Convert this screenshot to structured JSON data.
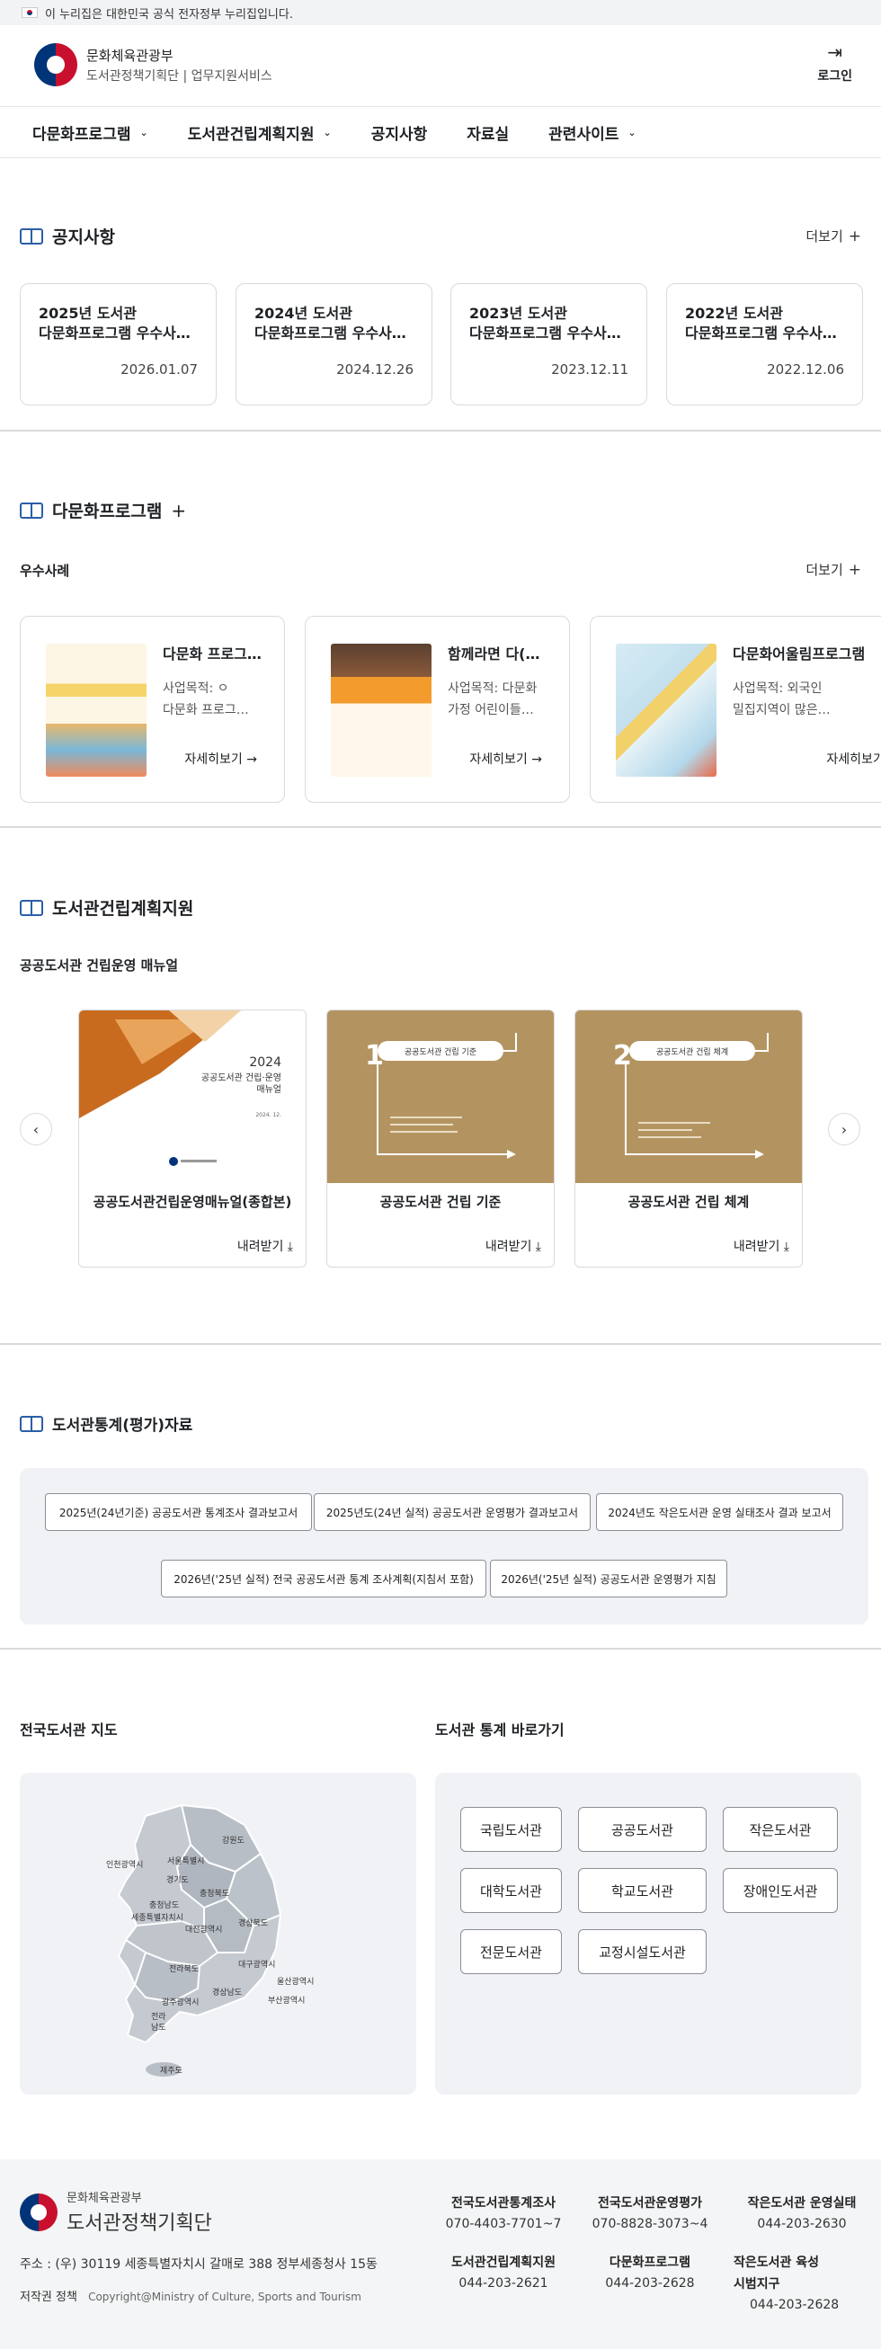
{
  "gov_banner": {
    "text": "이 누리집은 대한민국 공식 전자정부 누리집입니다."
  },
  "header": {
    "org": "문화체육관광부",
    "service": "도서관정책기획단 | 업무지원서비스",
    "login": "로그인"
  },
  "nav": [
    "다문화프로그램",
    "도서관건립계획지원",
    "공지사항",
    "자료실",
    "관련사이트"
  ],
  "notice": {
    "title": "공지사항",
    "more": "더보기",
    "items": [
      {
        "title1": "2025년 도서관",
        "title2": "다문화프로그램 우수사…",
        "date": "2026.01.07"
      },
      {
        "title1": "2024년 도서관",
        "title2": "다문화프로그램 우수사…",
        "date": "2024.12.26"
      },
      {
        "title1": "2023년 도서관",
        "title2": "다문화프로그램 우수사…",
        "date": "2023.12.11"
      },
      {
        "title1": "2022년 도서관",
        "title2": "다문화프로그램 우수사…",
        "date": "2022.12.06"
      }
    ]
  },
  "program": {
    "title": "다문화프로그램",
    "sub": "우수사례",
    "more": "더보기",
    "items": [
      {
        "title": "다문화 프로그…",
        "desc1": "사업목적: ㅇ",
        "desc2": "다문화 프로그…",
        "link": "자세히보기"
      },
      {
        "title": "함께라면 다(…",
        "desc1": "사업목적: 다문화",
        "desc2": "가정 어린이들…",
        "link": "자세히보기"
      },
      {
        "title": "다문화어울림프로그램",
        "desc1": "사업목적: 외국인",
        "desc2": "밀집지역이 많은…",
        "link": "자세히보기"
      }
    ]
  },
  "build": {
    "title": "도서관건립계획지원",
    "sub": "공공도서관 건립운영 매뉴얼",
    "cover1_year": "2024",
    "cover1_title1": "공공도서관 건립·운영",
    "cover1_title2": "매뉴얼",
    "cover1_date": "2024. 12.",
    "cover2_num": "1",
    "cover2_label": "공공도서관 건립 기준",
    "cover3_num": "2",
    "cover3_label": "공공도서관 건립 체계",
    "items": [
      {
        "title": "공공도서관건립운영매뉴얼(종합본)",
        "download": "내려받기"
      },
      {
        "title": "공공도서관 건립 기준",
        "download": "내려받기"
      },
      {
        "title": "공공도서관 건립 체계",
        "download": "내려받기"
      }
    ]
  },
  "stats": {
    "title": "도서관통계(평가)자료",
    "items": [
      "2025년(24년기준) 공공도서관 통계조사 결과보고서",
      "2025년도(24년 실적) 공공도서관 운영평가 결과보고서",
      "2024년도 작은도서관 운영 실태조사 결과 보고서",
      "2026년('25년 실적) 전국 공공도서관 통계 조사계획(지침서 포함)",
      "2026년('25년 실적) 공공도서관 운영평가 지침"
    ]
  },
  "map": {
    "title": "전국도서관 지도",
    "regions": [
      "강원도",
      "인천광역시",
      "서울특별시",
      "경기도",
      "충청북도",
      "충청남도",
      "세종특별자치시",
      "대전광역시",
      "경상북도",
      "전라북도",
      "대구광역시",
      "울산광역시",
      "경상남도",
      "부산광역시",
      "광주광역시",
      "전라",
      "남도",
      "제주도"
    ]
  },
  "shortcut": {
    "title": "도서관 통계 바로가기",
    "items": [
      "국립도서관",
      "공공도서관",
      "작은도서관",
      "대학도서관",
      "학교도서관",
      "장애인도서관",
      "전문도서관",
      "교정시설도서관"
    ]
  },
  "footer": {
    "org": "문화체육관광부",
    "name": "도서관정책기획단",
    "address": "주소 : (우) 30119 세종특별자치시 갈매로 388 정부세종청사 15동",
    "policy": "저작권 정책",
    "copyright": "Copyright@Ministry of Culture, Sports and Tourism",
    "contacts": [
      {
        "name": "전국도서관통계조사",
        "phone": "070-4403-7701~7"
      },
      {
        "name": "전국도서관운영평가",
        "phone": "070-8828-3073~4"
      },
      {
        "name": "작은도서관 운영실태",
        "phone": "044-203-2630"
      },
      {
        "name": "도서관건립계획지원",
        "phone": "044-203-2621"
      },
      {
        "name": "다문화프로그램",
        "phone": "044-203-2628"
      },
      {
        "name": "작은도서관 육성",
        "name2": "시범지구",
        "phone": "044-203-2628"
      }
    ]
  }
}
